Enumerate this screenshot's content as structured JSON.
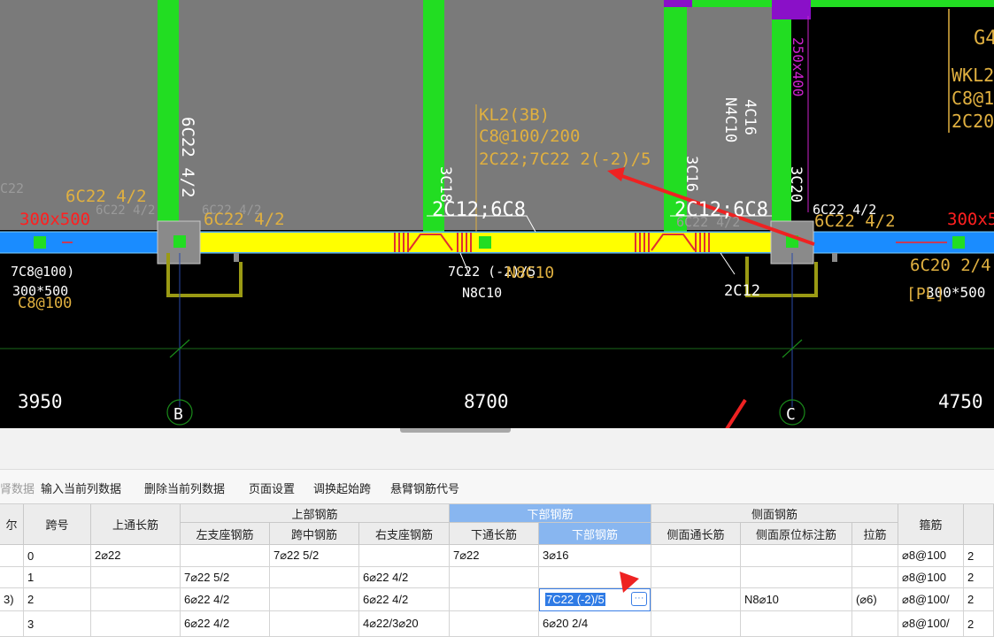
{
  "cad": {
    "dims": {
      "left": "3950",
      "mid": "8700",
      "right": "4750"
    },
    "axes": {
      "b": "B",
      "c": "C"
    },
    "beam_callout": {
      "line1": "KL2(3B)",
      "line2": "C8@100/200",
      "line3": "2C22;7C22 2(-2)/5"
    },
    "labels": {
      "col_left_v": "6C22 4/2",
      "beam_left_top": "6C22 4/2",
      "beam_left_top_ghost": "6C22 4/2",
      "beam_left_top_ghost2": "6C22 4/2",
      "beam_mid_top2": "6C22 4/2",
      "size_left": "300x500",
      "size_right": "300x5",
      "left_bottom1": "7C8@100)",
      "left_bottom2": "300*500",
      "left_bottom3": "C8@100",
      "left_c22": "C22",
      "mid_3c18": "3C18",
      "mid_stirrup_left": "2C12;6C8",
      "mid_stirrup_right": "2C12;6C8",
      "mid_ghost_right": "6C22 4/2",
      "mid_bottom1": "7C22 (-2)/5",
      "mid_bottom2": "N8C10",
      "mid_bottom3": "N8C10",
      "mid_2c12": "2C12",
      "right_3c16": "3C16",
      "right_4c16a": "4C16",
      "right_4c16b": "N4C10",
      "right_3c20": "3C20",
      "right_250": "250x400",
      "right_top": "6C22 4/2",
      "right_top2": "6C22 4/2",
      "far_right_bottom1": "6C20 2/4",
      "far_right_bottom2": "300*500",
      "far_right_pl": "[PL]",
      "g4": "G4",
      "wkl_1": "WKL2",
      "wkl_2": "C8@1",
      "wkl_3": "2C20;"
    }
  },
  "toolbar": {
    "items": [
      "肾数据",
      "输入当前列数据",
      "删除当前列数据",
      "页面设置",
      "调换起始跨",
      "悬臂钢筋代号"
    ]
  },
  "grid": {
    "headers": {
      "col0": "尔",
      "span": "跨号",
      "top_through": "上通长筋",
      "top_group": "上部钢筋",
      "top_left": "左支座钢筋",
      "top_mid": "跨中钢筋",
      "top_right": "右支座钢筋",
      "bottom_group": "下部钢筋",
      "bottom_through": "下通长筋",
      "bottom_bars": "下部钢筋",
      "side_group": "侧面钢筋",
      "side_through": "侧面通长筋",
      "side_orig": "侧面原位标注筋",
      "tie": "拉筋",
      "stirrup": "箍筋"
    },
    "rows": [
      {
        "c0": "",
        "span": "0",
        "top_through": "2⌀22",
        "top_left": "",
        "top_mid": "7⌀22 5/2",
        "top_right": "",
        "bottom_through": "7⌀22",
        "bottom_bars": "3⌀16",
        "side_through": "",
        "side_orig": "",
        "tie": "",
        "stirrup": "⌀8@100",
        "last": "2"
      },
      {
        "c0": "",
        "span": "1",
        "top_through": "",
        "top_left": "7⌀22 5/2",
        "top_mid": "",
        "top_right": "6⌀22 4/2",
        "bottom_through": "",
        "bottom_bars": "",
        "side_through": "",
        "side_orig": "",
        "tie": "",
        "stirrup": "⌀8@100",
        "last": "2"
      },
      {
        "c0": "3)",
        "span": "2",
        "top_through": "",
        "top_left": "6⌀22 4/2",
        "top_mid": "",
        "top_right": "6⌀22 4/2",
        "bottom_through": "",
        "bottom_bars": "",
        "side_through": "",
        "side_orig": "N8⌀10",
        "tie": "(⌀6)",
        "stirrup": "⌀8@100/",
        "last": "2"
      },
      {
        "c0": "",
        "span": "3",
        "top_through": "",
        "top_left": "6⌀22 4/2",
        "top_mid": "",
        "top_right": "4⌀22/3⌀20",
        "bottom_through": "",
        "bottom_bars": "6⌀20 2/4",
        "side_through": "",
        "side_orig": "",
        "tie": "",
        "stirrup": "⌀8@100/",
        "last": "2"
      }
    ],
    "editing_value": "7C22 (-2)/5",
    "ellipsis": "···"
  },
  "colors": {
    "column_green": "#22dd22",
    "beam_yellow": "#ffff00",
    "beam_blue": "#1a8cff",
    "slab_gray": "#7a7a7a",
    "annotation": "#e0b040",
    "dim_red": "#ff2020",
    "arrow_red": "#ee2222",
    "header_selected": "#88b6f0"
  }
}
